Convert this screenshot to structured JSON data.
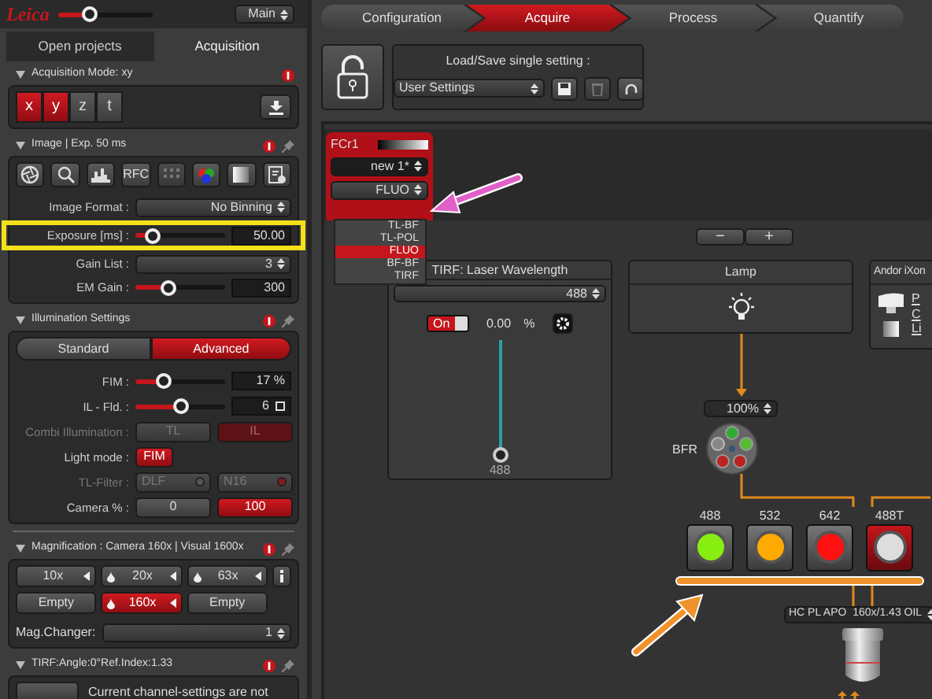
{
  "header": {
    "logo": "Leica",
    "slider": {
      "level": 0.3
    },
    "view": "Main"
  },
  "workflow_tabs": [
    {
      "label": "Configuration",
      "selected": false
    },
    {
      "label": "Acquire",
      "selected": true
    },
    {
      "label": "Process",
      "selected": false
    },
    {
      "label": "Quantify",
      "selected": false
    }
  ],
  "panel_tabs": [
    {
      "label": "Open projects",
      "selected": false
    },
    {
      "label": "Acquisition",
      "selected": true
    }
  ],
  "acquisition_mode": {
    "title": "Acquisition Mode: xy",
    "axes": [
      {
        "label": "x",
        "selected": true
      },
      {
        "label": "y",
        "selected": true
      },
      {
        "label": "z",
        "selected": false
      },
      {
        "label": "t",
        "selected": false
      }
    ]
  },
  "image": {
    "title": "Image | Exp. 50 ms",
    "tools": [
      {
        "kind": "aperture",
        "disabled": false
      },
      {
        "kind": "zoom",
        "disabled": false
      },
      {
        "kind": "histogram",
        "disabled": false
      },
      {
        "kind": "text",
        "label": "RFC",
        "disabled": false
      },
      {
        "kind": "grid",
        "disabled": true
      },
      {
        "kind": "colors",
        "disabled": false
      },
      {
        "kind": "gradient",
        "disabled": false
      },
      {
        "kind": "settings",
        "disabled": false
      }
    ],
    "rows": [
      {
        "kind": "select",
        "label": "Image Format :",
        "value": "No Binning"
      },
      {
        "kind": "slider",
        "label": "Exposure [ms] :",
        "level": 0.12,
        "value": "50.00",
        "highlighted": true
      },
      {
        "kind": "select",
        "label": "Gain List :",
        "value": "3"
      },
      {
        "kind": "slider",
        "label": "EM Gain :",
        "level": 0.33,
        "value": "300"
      }
    ]
  },
  "illumination": {
    "title": "Illumination Settings",
    "modes": [
      {
        "label": "Standard",
        "selected": false
      },
      {
        "label": "Advanced",
        "selected": true
      }
    ],
    "rows": [
      {
        "kind": "slider",
        "label": "FIM :",
        "level": 0.28,
        "value": "17 %"
      },
      {
        "kind": "slider",
        "label": "IL - Fld. :",
        "level": 0.5,
        "value": "6",
        "unit_icon": true
      },
      {
        "kind": "buttons",
        "label": "Combi Illumination :",
        "disabled": true,
        "buttons": [
          {
            "label": "TL",
            "selected": false
          },
          {
            "label": "IL",
            "selected": true
          }
        ]
      },
      {
        "kind": "buttons",
        "label": "Light mode :",
        "disabled": false,
        "buttons": [
          {
            "label": "FIM",
            "selected": true
          }
        ]
      },
      {
        "kind": "buttons",
        "label": "TL-Filter :",
        "disabled": true,
        "buttons": [
          {
            "label": "DLF",
            "selected": false,
            "lamp": false
          },
          {
            "label": "N16",
            "selected": false,
            "lamp": true
          }
        ]
      },
      {
        "kind": "buttons",
        "label": "Camera % :",
        "disabled": false,
        "buttons": [
          {
            "label": "0",
            "selected": false
          },
          {
            "label": "100",
            "selected": true
          }
        ]
      }
    ]
  },
  "magnification": {
    "title": "Magnification : Camera 160x | Visual 1600x",
    "objectives": [
      {
        "label": "10x",
        "kind": "objective",
        "immersion": false,
        "selected": false
      },
      {
        "label": "20x",
        "kind": "objective",
        "immersion": true,
        "selected": false
      },
      {
        "label": "63x",
        "kind": "objective",
        "immersion": true,
        "selected": false
      },
      {
        "label": "Empty",
        "kind": "empty",
        "selected": false
      },
      {
        "label": "160x",
        "kind": "objective",
        "immersion": true,
        "selected": true
      },
      {
        "label": "Empty",
        "kind": "empty",
        "selected": false
      }
    ],
    "changer": {
      "label": "Mag.Changer:",
      "value": "1"
    }
  },
  "tirf": {
    "title": "TIRF:Angle:0°Ref.Index:1.33",
    "message": "Current channel-settings are not"
  },
  "setting": {
    "label": "Load/Save single setting :",
    "value": "User Settings"
  },
  "channel": {
    "name": "FCr1",
    "setting": "new 1*",
    "contrast": "FLUO",
    "options": [
      {
        "label": "TL-BF",
        "selected": false
      },
      {
        "label": "TL-POL",
        "selected": false
      },
      {
        "label": "FLUO",
        "selected": true
      },
      {
        "label": "BF-BF",
        "selected": false
      },
      {
        "label": "TIRF",
        "selected": false
      }
    ]
  },
  "zoom_buttons": [
    "−",
    "+"
  ],
  "laser_panel": {
    "title": "TIRF: Laser Wavelength",
    "wavelength": "488",
    "on": true,
    "toggle_label": "On",
    "reading": "0.00",
    "unit": "%",
    "level": 0,
    "slider_label": "488"
  },
  "lamp": {
    "title": "Lamp",
    "intensity": "100%",
    "wheel_label": "BFR"
  },
  "camera": {
    "title": "Andor iXon",
    "links": [
      "P",
      "C",
      "Li"
    ]
  },
  "lasers": [
    {
      "label": "488",
      "color": "#88ee11",
      "selected": false
    },
    {
      "label": "532",
      "color": "#ffaa00",
      "selected": false
    },
    {
      "label": "642",
      "color": "#ff1111",
      "selected": false
    },
    {
      "label": "488T",
      "color": "#dddddd",
      "selected": true
    }
  ],
  "objective": "HC PL APO  160x/1.43 OIL"
}
